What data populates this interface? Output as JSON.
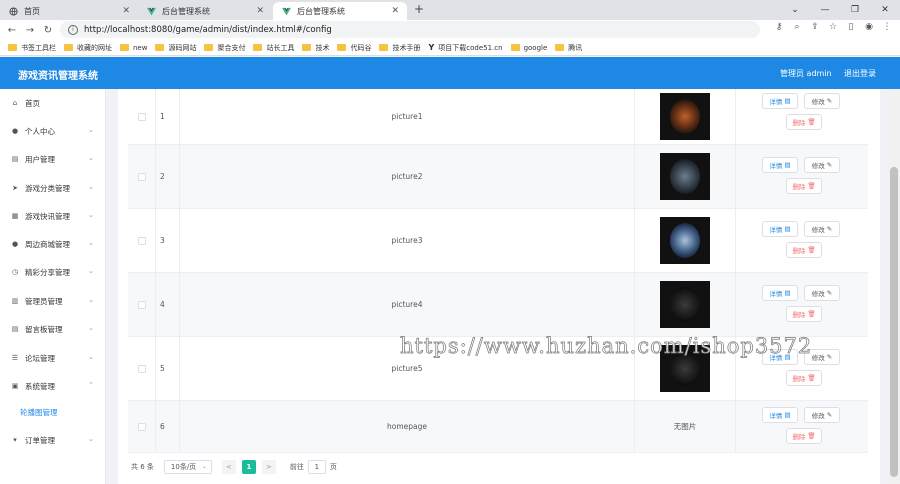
{
  "browser": {
    "tabs": [
      {
        "title": "首页"
      },
      {
        "title": "后台管理系统"
      },
      {
        "title": "后台管理系统"
      }
    ],
    "url": "http://localhost:8080/game/admin/dist/index.html#/config",
    "bookmarks": [
      "书签工具栏",
      "收藏的网址",
      "new",
      "源码网站",
      "聚合支付",
      "站长工具",
      "技术",
      "代码谷",
      "技术手册",
      "项目下载code51.cn",
      "google",
      "腾讯"
    ]
  },
  "header": {
    "title": "游戏资讯管理系统",
    "user": "管理员 admin",
    "logout": "退出登录"
  },
  "sidebar": {
    "items": [
      {
        "label": "首页"
      },
      {
        "label": "个人中心"
      },
      {
        "label": "用户管理"
      },
      {
        "label": "游戏分类管理"
      },
      {
        "label": "游戏快讯管理"
      },
      {
        "label": "周边商城管理"
      },
      {
        "label": "精彩分享管理"
      },
      {
        "label": "管理员管理"
      },
      {
        "label": "留言板管理"
      },
      {
        "label": "论坛管理"
      },
      {
        "label": "系统管理"
      },
      {
        "label": "轮播图管理"
      },
      {
        "label": "订单管理"
      }
    ]
  },
  "table": {
    "rows": [
      {
        "index": "1",
        "name": "picture1",
        "image": "",
        "thumb_text": ""
      },
      {
        "index": "2",
        "name": "picture2",
        "image": "",
        "thumb_text": ""
      },
      {
        "index": "3",
        "name": "picture3",
        "image": "",
        "thumb_text": ""
      },
      {
        "index": "4",
        "name": "picture4",
        "image": "",
        "thumb_text": ""
      },
      {
        "index": "5",
        "name": "picture5",
        "image": "",
        "thumb_text": ""
      },
      {
        "index": "6",
        "name": "homepage",
        "image": "无图片",
        "thumb_text": ""
      }
    ],
    "actions": {
      "detail": "详情",
      "edit": "修改",
      "delete": "删除"
    }
  },
  "pagination": {
    "total": "共 6 条",
    "page_size": "10条/页",
    "prev": "<",
    "current": "1",
    "next": ">",
    "goto_prefix": "前往",
    "goto_value": "1",
    "goto_suffix": "页"
  },
  "watermark": "https://www.huzhan.com/ishop3572",
  "colors": {
    "header": "#1e88e5",
    "active_page": "#1abc9c",
    "delete": "#f56c6c"
  }
}
